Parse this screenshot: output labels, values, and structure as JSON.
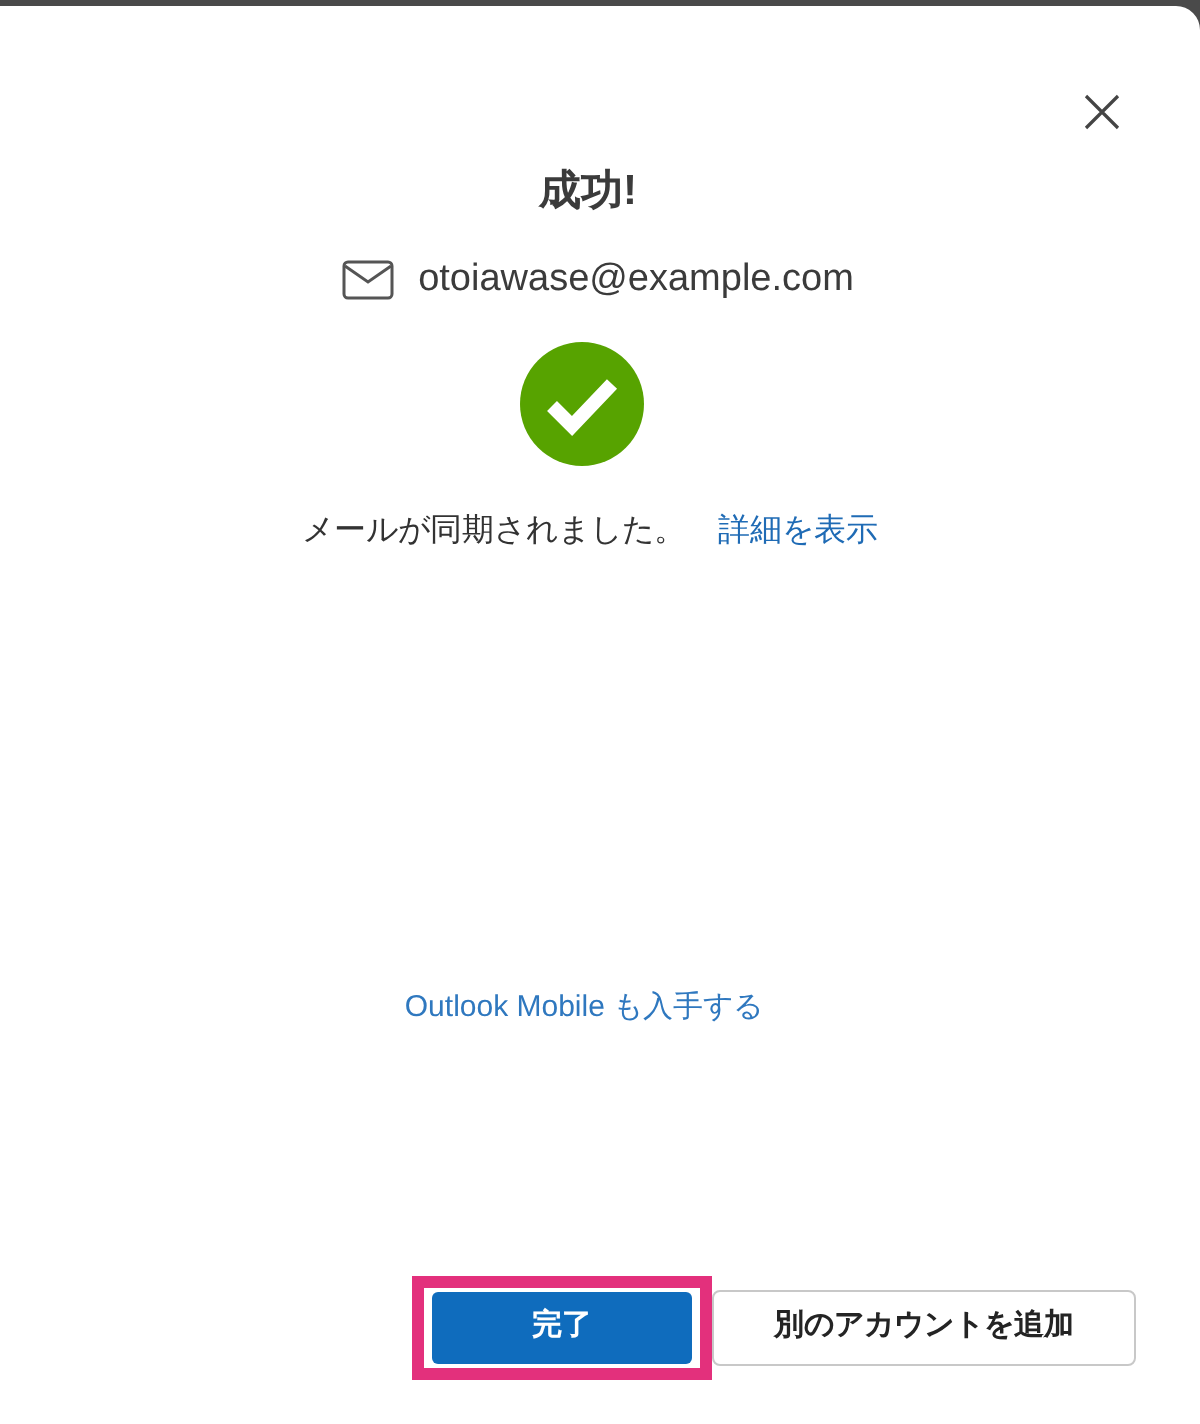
{
  "dialog": {
    "title": "成功!",
    "email": "otoiawase@example.com",
    "message": "メールが同期されました。",
    "details_link": "詳細を表示",
    "mobile_link": "Outlook Mobile も入手する",
    "buttons": [
      {
        "label": "完了",
        "kind": "primary",
        "highlighted": true
      },
      {
        "label": "別のアカウントを追加",
        "kind": "secondary",
        "highlighted": false
      }
    ]
  }
}
